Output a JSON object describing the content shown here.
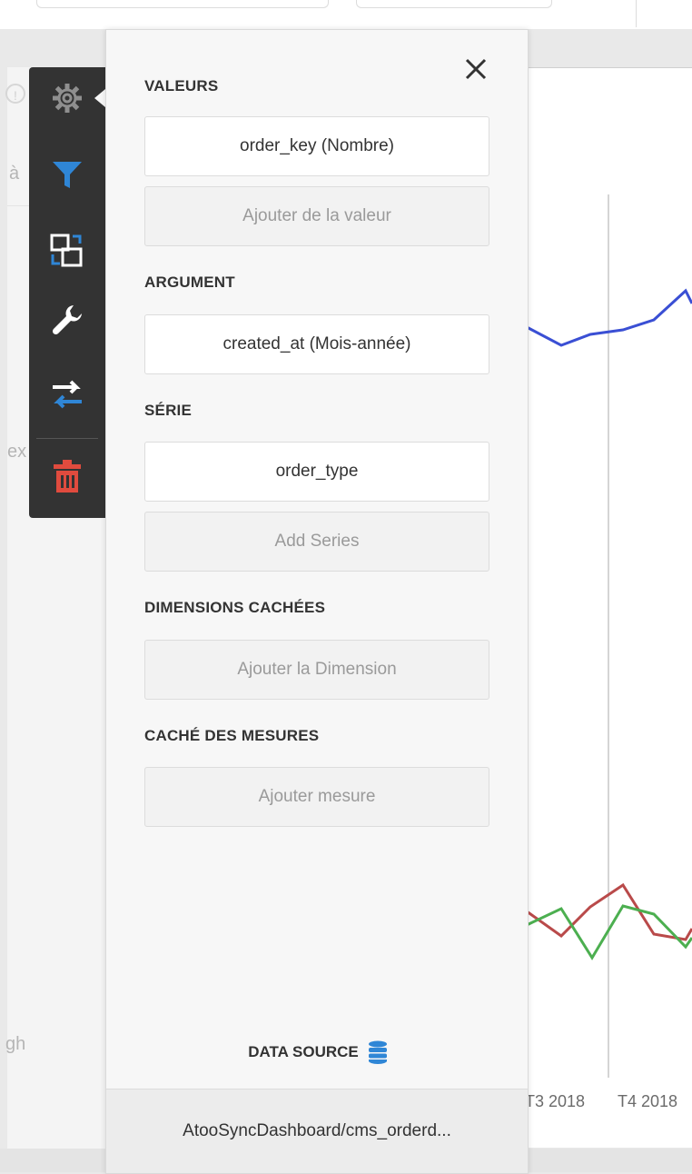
{
  "background": {
    "left_fragments": [
      "à",
      "ex",
      "gh"
    ]
  },
  "chart": {
    "tick_labels": [
      "T3 2018",
      "T4 2018"
    ],
    "colors": {
      "blue": "#3a4fd4",
      "red": "#b94a4a",
      "green": "#4caf50"
    }
  },
  "toolbar": {
    "items": [
      {
        "name": "gear-icon",
        "color": "#8f8f8f"
      },
      {
        "name": "filter-icon",
        "color": "#2f86d6"
      },
      {
        "name": "convert-icon",
        "color": "#ffffff"
      },
      {
        "name": "wrench-icon",
        "color": "#ffffff"
      },
      {
        "name": "swap-icon",
        "color": "#ffffff"
      },
      {
        "name": "trash-icon",
        "color": "#e04b3e"
      }
    ]
  },
  "panel": {
    "close_label": "×",
    "sections": {
      "values": {
        "title": "VALEURS",
        "items": [
          "order_key (Nombre)"
        ],
        "add_label": "Ajouter de la valeur"
      },
      "argument": {
        "title": "ARGUMENT",
        "items": [
          "created_at (Mois-année)"
        ]
      },
      "series": {
        "title": "SÉRIE",
        "items": [
          "order_type"
        ],
        "add_label": "Add Series"
      },
      "hidden_dimensions": {
        "title": "DIMENSIONS CACHÉES",
        "add_label": "Ajouter la Dimension"
      },
      "hidden_measures": {
        "title": "CACHÉ DES MESURES",
        "add_label": "Ajouter mesure"
      }
    },
    "data_source": {
      "title": "DATA SOURCE",
      "icon": "database-icon",
      "icon_color": "#2f86d6",
      "name": "AtooSyncDashboard/cms_orderd..."
    }
  }
}
